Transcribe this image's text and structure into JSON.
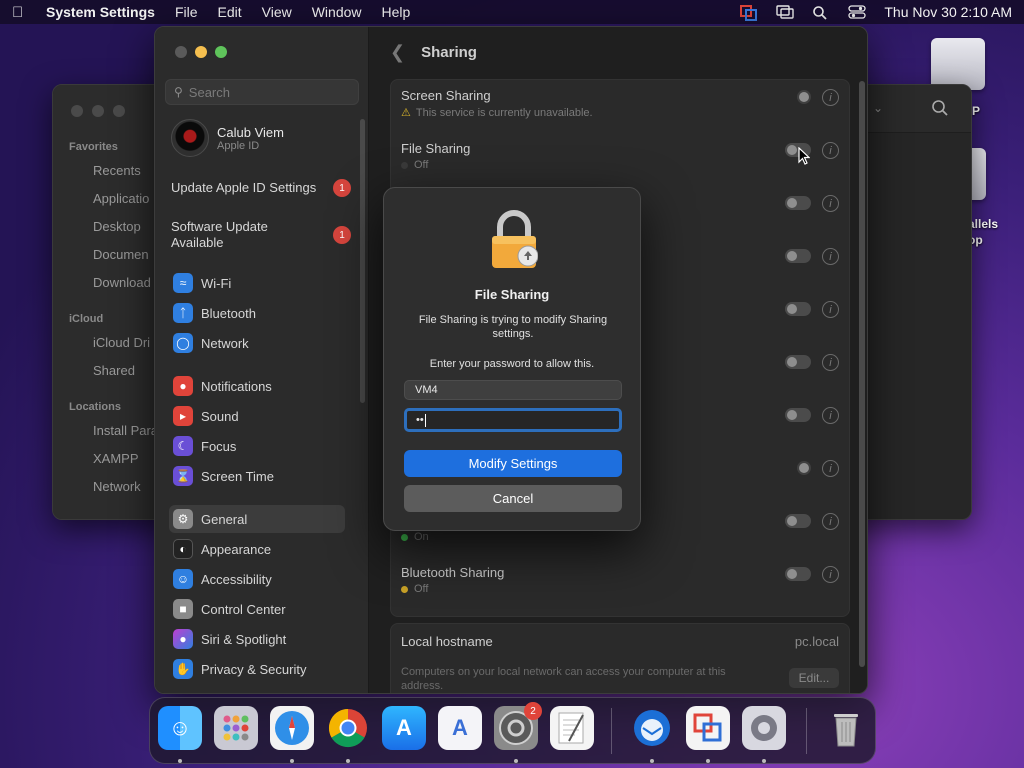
{
  "menubar": {
    "app_name": "System Settings",
    "items": [
      "File",
      "Edit",
      "View",
      "Window",
      "Help"
    ],
    "datetime": "Thu Nov 30  2:10 AM"
  },
  "desktop": {
    "icon1_label": "P",
    "icon2_label_line1": "allels",
    "icon2_label_line2": "op"
  },
  "finder": {
    "favorites_header": "Favorites",
    "favorites": [
      "Recents",
      "Applicatio",
      "Desktop",
      "Documen",
      "Download"
    ],
    "icloud_header": "iCloud",
    "icloud": [
      "iCloud Dri",
      "Shared"
    ],
    "locations_header": "Locations",
    "locations": [
      "Install Para",
      "XAMPP",
      "Network"
    ]
  },
  "sidebar": {
    "search_placeholder": "Search",
    "account_name": "Calub Viem",
    "account_sub": "Apple ID",
    "update1_label": "Update Apple ID Settings",
    "update1_badge": "1",
    "update2_label": "Software Update Available",
    "update2_badge": "1",
    "items": [
      {
        "label": "Wi-Fi",
        "color": "#2f7fe0"
      },
      {
        "label": "Bluetooth",
        "color": "#2f7fe0"
      },
      {
        "label": "Network",
        "color": "#2f7fe0"
      },
      {
        "label": "Notifications",
        "color": "#e0443a"
      },
      {
        "label": "Sound",
        "color": "#e0443a"
      },
      {
        "label": "Focus",
        "color": "#6a4fd6"
      },
      {
        "label": "Screen Time",
        "color": "#6a4fd6"
      },
      {
        "label": "General",
        "color": "#8a8a8a"
      },
      {
        "label": "Appearance",
        "color": "#222222"
      },
      {
        "label": "Accessibility",
        "color": "#2f7fe0"
      },
      {
        "label": "Control Center",
        "color": "#8a8a8a"
      },
      {
        "label": "Siri & Spotlight",
        "color": "#c03fd0"
      },
      {
        "label": "Privacy & Security",
        "color": "#2f7fe0"
      }
    ]
  },
  "content": {
    "title": "Sharing",
    "rows": [
      {
        "title": "Screen Sharing",
        "status": "This service is currently unavailable."
      },
      {
        "title": "File Sharing",
        "status": "Off"
      },
      {
        "title": "Bluetooth Sharing",
        "status": "Off"
      }
    ],
    "partial_status_on": "On",
    "hostname_label": "Local hostname",
    "hostname_value": "pc.local",
    "hostname_desc": "Computers on your local network can access your computer at this address.",
    "edit_button": "Edit..."
  },
  "dialog": {
    "title": "File Sharing",
    "message": "File Sharing is trying to modify Sharing settings.",
    "prompt": "Enter your password to allow this.",
    "username_value": "VM4",
    "password_value": "••",
    "primary_button": "Modify Settings",
    "secondary_button": "Cancel"
  },
  "dock": {
    "system_settings_badge": "2"
  },
  "colors": {
    "accent": "#1e6fde",
    "badge": "#d6453d",
    "status_off": "#c9a227",
    "status_on": "#3fbf4f"
  }
}
